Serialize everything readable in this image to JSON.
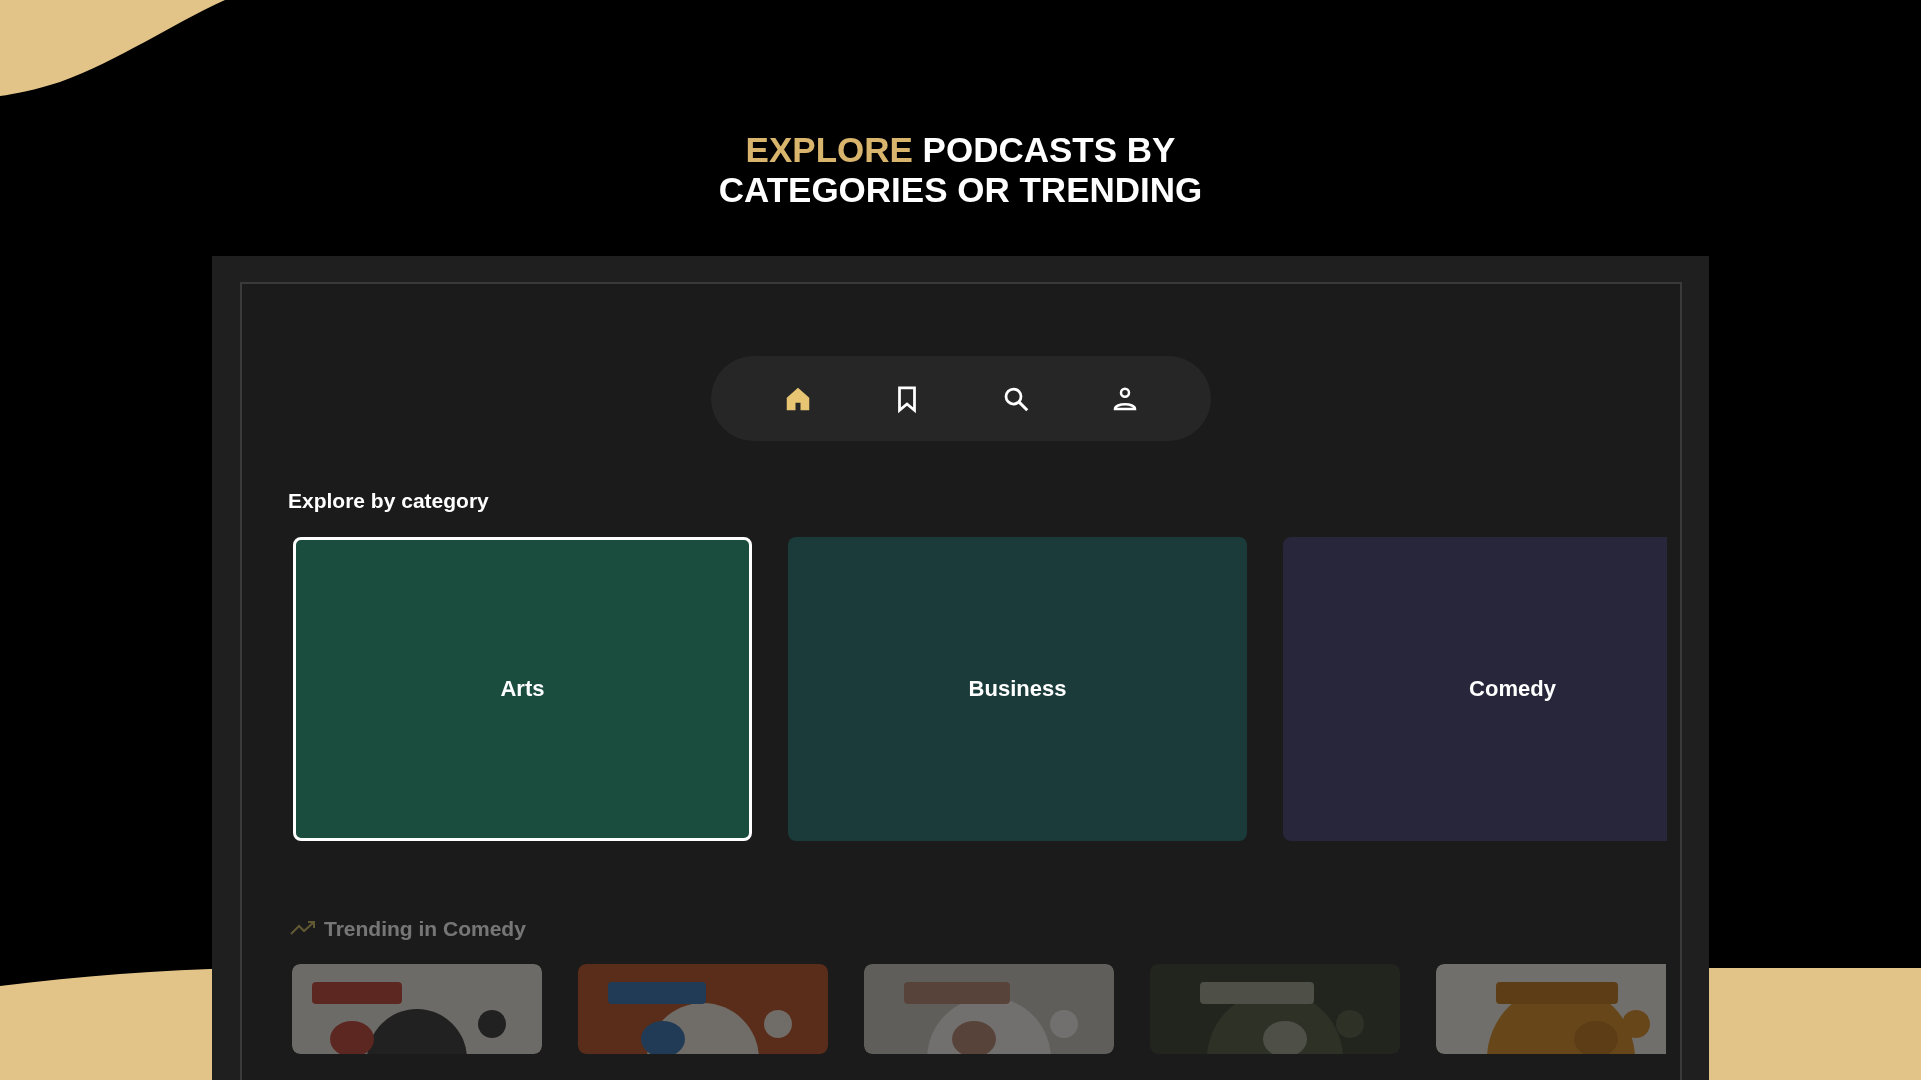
{
  "headline": {
    "accent": "EXPLORE",
    "rest": "PODCASTS BY CATEGORIES OR TRENDING"
  },
  "nav": [
    {
      "kind": "home",
      "selected": true
    },
    {
      "kind": "bookmark",
      "selected": false
    },
    {
      "kind": "search",
      "selected": false
    },
    {
      "kind": "profile",
      "selected": false
    }
  ],
  "categories": {
    "title": "Explore by category",
    "items": [
      {
        "label": "Arts",
        "color": "#1a4d3e",
        "selected": true
      },
      {
        "label": "Business",
        "color": "#1b3a3a",
        "selected": false
      },
      {
        "label": "Comedy",
        "color": "#28263a",
        "selected": false
      }
    ]
  },
  "trending": {
    "title": "Trending in Comedy"
  }
}
